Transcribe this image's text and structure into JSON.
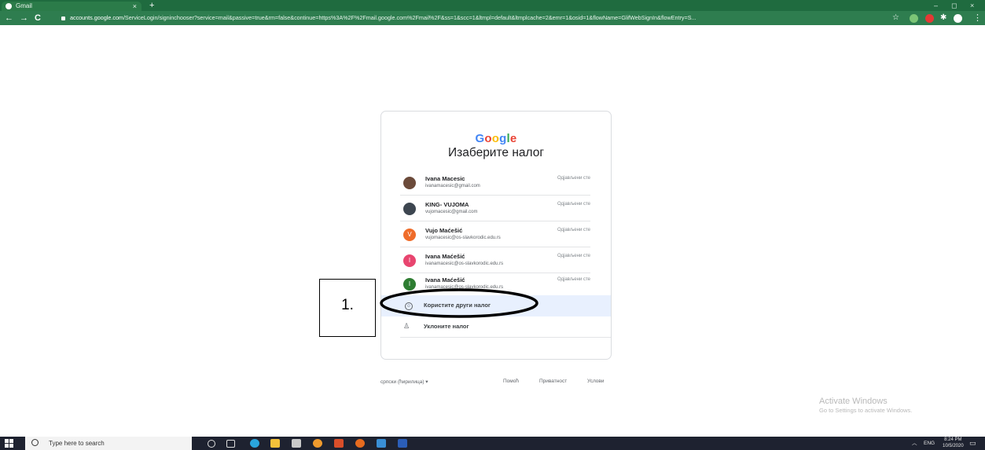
{
  "browser": {
    "tab_title": "Gmail",
    "tab_close": "×",
    "new_tab": "+",
    "window_controls": [
      "–",
      "◻",
      "×"
    ],
    "nav": {
      "back": "←",
      "forward": "→",
      "reload": "C"
    },
    "address_host": "accounts.google.com",
    "address_rest": "/ServiceLogin/signinchooser?service=mail&passive=true&rm=false&continue=https%3A%2F%2Fmail.google.com%2Fmail%2F&ss=1&scc=1&ltmpl=default&ltmplcache=2&emr=1&osid=1&flowName=GlifWebSignIn&flowEntry=S..."
  },
  "card": {
    "logo": [
      "G",
      "o",
      "o",
      "g",
      "l",
      "e"
    ],
    "logo_colors": [
      "#4285f4",
      "#ea4335",
      "#fbbc05",
      "#4285f4",
      "#34a853",
      "#ea4335"
    ],
    "heading": "Изаберите налог",
    "accounts": [
      {
        "name": "Ivana Macesic",
        "email": "ivanamacesic@gmail.com",
        "status": "Одјављени сте",
        "avatar_letter": "",
        "avatar_color": "#6b4a3a"
      },
      {
        "name": "KING- VUJOMA",
        "email": "vujomacesic@gmail.com",
        "status": "Одјављени сте",
        "avatar_letter": "",
        "avatar_color": "#3d4650"
      },
      {
        "name": "Vujo Maćešić",
        "email": "vujomacesic@os-slavkorodic.edu.rs",
        "status": "Одјављени сте",
        "avatar_letter": "V",
        "avatar_color": "#ef6c2a"
      },
      {
        "name": "Ivana Maćešić",
        "email": "ivanamacesic@os-slavkorodic.edu.rs",
        "status": "Одјављени сте",
        "avatar_letter": "I",
        "avatar_color": "#e8456f"
      },
      {
        "name": "Ivana Maćešić",
        "email": "ivanamacesic@os-slavkorodic.edu.rs",
        "status": "Одјављени сте",
        "avatar_letter": "I",
        "avatar_color": "#2e7d32"
      }
    ],
    "use_other": "Користите други налог",
    "remove": "Уклоните налог"
  },
  "footer": {
    "language": "српски (ћирилица)",
    "help": "Помоћ",
    "privacy": "Приватност",
    "terms": "Услови"
  },
  "annotation": {
    "number": "1."
  },
  "watermark": {
    "line1": "Activate Windows",
    "line2": "Go to Settings to activate Windows."
  },
  "taskbar": {
    "search_placeholder": "Type here to search",
    "lang": "ENG",
    "time": "8:24 PM",
    "date": "10/5/2020"
  }
}
